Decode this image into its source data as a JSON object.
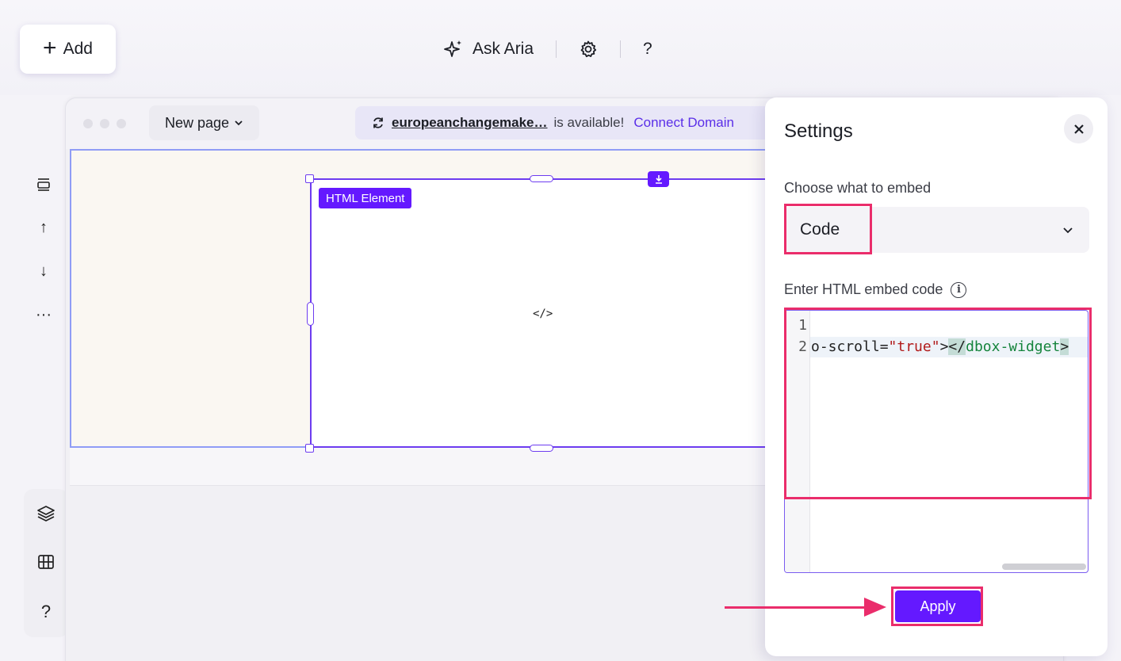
{
  "toolbar": {
    "add_label": "Add",
    "ask_aria_label": "Ask Aria",
    "help_label": "?"
  },
  "left_rail": {
    "more_label": "···",
    "help_label": "?"
  },
  "canvas": {
    "page_selector_label": "New page",
    "domain_name": "europeanchangemake…",
    "domain_status": "is available!",
    "connect_domain_label": "Connect Domain",
    "element_tag_label": "HTML Element",
    "code_icon_label": "</>"
  },
  "settings": {
    "title": "Settings",
    "embed_type_label": "Choose what to embed",
    "embed_type_value": "Code",
    "embed_code_label": "Enter HTML embed code",
    "code_lines": {
      "line1_number": "1",
      "line2_number": "2",
      "line2_attr": "o-scroll=",
      "line2_string": "\"true\"",
      "line2_close": ">",
      "line2_tag_open": "</",
      "line2_tag_name": "dbox-widget",
      "line2_tag_end": ">"
    },
    "apply_label": "Apply"
  },
  "colors": {
    "accent": "#6419ff",
    "annotation": "#ea2d6b",
    "selection_border": "#8f9cf6"
  }
}
